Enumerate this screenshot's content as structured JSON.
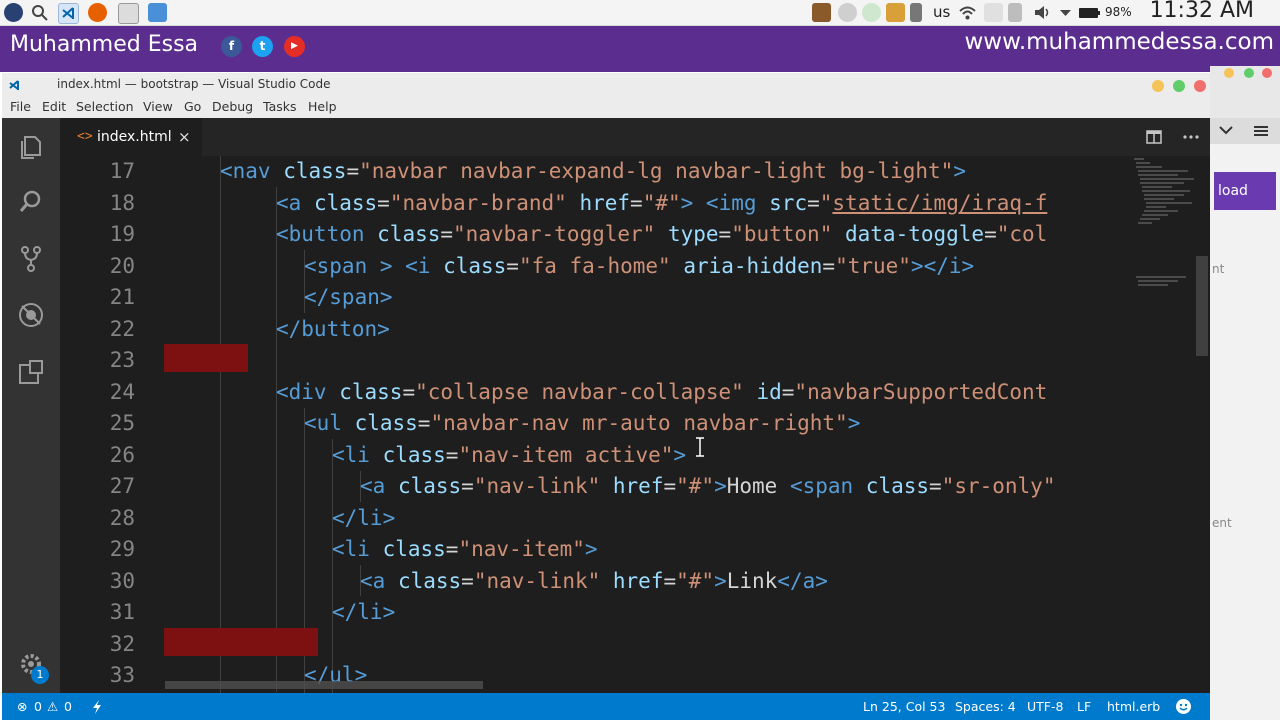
{
  "taskbar": {
    "keyboard_layout": "us",
    "battery": "98%",
    "clock": "11:32 AM"
  },
  "banner": {
    "name": "Muhammed Essa",
    "website": "www.muhammedessa.com",
    "social": [
      {
        "icon": "facebook-icon",
        "glyph": "f",
        "color": "#3b5998"
      },
      {
        "icon": "twitter-icon",
        "glyph": "t",
        "color": "#1da1f2"
      },
      {
        "icon": "youtube-icon",
        "glyph": "▶",
        "color": "#e52d27"
      }
    ]
  },
  "background_window": {
    "button_text": "load",
    "side_text_1": "nt",
    "side_text_2": "ent"
  },
  "window": {
    "title": "index.html — bootstrap — Visual Studio Code",
    "menu": [
      "File",
      "Edit",
      "Selection",
      "View",
      "Go",
      "Debug",
      "Tasks",
      "Help"
    ]
  },
  "tab": {
    "label": "index.html",
    "close": "×",
    "icon_glyph": "<>"
  },
  "editor": {
    "lines": [
      {
        "num": "17",
        "indent": 2,
        "tokens": [
          [
            "tg",
            "<nav "
          ],
          [
            "at",
            "class"
          ],
          [
            "tx",
            "="
          ],
          [
            "st",
            "\"navbar navbar-expand-lg navbar-light bg-light\""
          ],
          [
            "tg",
            ">"
          ]
        ]
      },
      {
        "num": "18",
        "indent": 4,
        "tokens": [
          [
            "tg",
            "<a "
          ],
          [
            "at",
            "class"
          ],
          [
            "tx",
            "="
          ],
          [
            "st",
            "\"navbar-brand\" "
          ],
          [
            "at",
            "href"
          ],
          [
            "tx",
            "="
          ],
          [
            "st",
            "\"#\""
          ],
          [
            "tg",
            "> <img "
          ],
          [
            "at",
            "src"
          ],
          [
            "tx",
            "="
          ],
          [
            "st",
            "\""
          ],
          [
            "stl",
            "static/img/iraq-f"
          ]
        ]
      },
      {
        "num": "19",
        "indent": 4,
        "tokens": [
          [
            "tg",
            "<button "
          ],
          [
            "at",
            "class"
          ],
          [
            "tx",
            "="
          ],
          [
            "st",
            "\"navbar-toggler\" "
          ],
          [
            "at",
            "type"
          ],
          [
            "tx",
            "="
          ],
          [
            "st",
            "\"button\" "
          ],
          [
            "at",
            "data-toggle"
          ],
          [
            "tx",
            "="
          ],
          [
            "st",
            "\"col"
          ]
        ]
      },
      {
        "num": "20",
        "indent": 5,
        "tokens": [
          [
            "tg",
            "<span > <i "
          ],
          [
            "at",
            "class"
          ],
          [
            "tx",
            "="
          ],
          [
            "st",
            "\"fa fa-home\" "
          ],
          [
            "at",
            "aria-hidden"
          ],
          [
            "tx",
            "="
          ],
          [
            "st",
            "\"true\""
          ],
          [
            "tg",
            "></i>"
          ]
        ]
      },
      {
        "num": "21",
        "indent": 5,
        "tokens": [
          [
            "tg",
            "</span>"
          ]
        ]
      },
      {
        "num": "22",
        "indent": 4,
        "tokens": [
          [
            "tg",
            "</button>"
          ]
        ]
      },
      {
        "num": "23",
        "indent": 0,
        "tokens": []
      },
      {
        "num": "24",
        "indent": 4,
        "tokens": [
          [
            "tg",
            "<div "
          ],
          [
            "at",
            "class"
          ],
          [
            "tx",
            "="
          ],
          [
            "st",
            "\"collapse navbar-collapse\" "
          ],
          [
            "at",
            "id"
          ],
          [
            "tx",
            "="
          ],
          [
            "st",
            "\"navbarSupportedCont"
          ]
        ]
      },
      {
        "num": "25",
        "indent": 5,
        "tokens": [
          [
            "tg",
            "<ul "
          ],
          [
            "at",
            "class"
          ],
          [
            "tx",
            "="
          ],
          [
            "st",
            "\"navbar-nav mr-auto navbar-right\""
          ],
          [
            "tg",
            ">"
          ]
        ]
      },
      {
        "num": "26",
        "indent": 6,
        "tokens": [
          [
            "tg",
            "<li "
          ],
          [
            "at",
            "class"
          ],
          [
            "tx",
            "="
          ],
          [
            "st",
            "\"nav-item active\""
          ],
          [
            "tg",
            ">"
          ]
        ]
      },
      {
        "num": "27",
        "indent": 7,
        "tokens": [
          [
            "tg",
            "<a "
          ],
          [
            "at",
            "class"
          ],
          [
            "tx",
            "="
          ],
          [
            "st",
            "\"nav-link\" "
          ],
          [
            "at",
            "href"
          ],
          [
            "tx",
            "="
          ],
          [
            "st",
            "\"#\""
          ],
          [
            "tg",
            ">"
          ],
          [
            "tx",
            "Home "
          ],
          [
            "tg",
            "<span "
          ],
          [
            "at",
            "class"
          ],
          [
            "tx",
            "="
          ],
          [
            "st",
            "\"sr-only\""
          ]
        ]
      },
      {
        "num": "28",
        "indent": 6,
        "tokens": [
          [
            "tg",
            "</li>"
          ]
        ]
      },
      {
        "num": "29",
        "indent": 6,
        "tokens": [
          [
            "tg",
            "<li "
          ],
          [
            "at",
            "class"
          ],
          [
            "tx",
            "="
          ],
          [
            "st",
            "\"nav-item\""
          ],
          [
            "tg",
            ">"
          ]
        ]
      },
      {
        "num": "30",
        "indent": 7,
        "tokens": [
          [
            "tg",
            "<a "
          ],
          [
            "at",
            "class"
          ],
          [
            "tx",
            "="
          ],
          [
            "st",
            "\"nav-link\" "
          ],
          [
            "at",
            "href"
          ],
          [
            "tx",
            "="
          ],
          [
            "st",
            "\"#\""
          ],
          [
            "tg",
            ">"
          ],
          [
            "tx",
            "Link"
          ],
          [
            "tg",
            "</a>"
          ]
        ]
      },
      {
        "num": "31",
        "indent": 6,
        "tokens": [
          [
            "tg",
            "</li>"
          ]
        ]
      },
      {
        "num": "32",
        "indent": 0,
        "tokens": []
      },
      {
        "num": "33",
        "indent": 5,
        "tokens": [
          [
            "tg",
            "</ul>"
          ]
        ]
      }
    ],
    "error_lines": [
      "23",
      "32"
    ]
  },
  "status": {
    "errors": "0",
    "warnings": "0",
    "position": "Ln 25, Col 53",
    "spaces": "Spaces: 4",
    "encoding": "UTF-8",
    "eol": "LF",
    "language": "html.erb"
  },
  "settings_badge": "1",
  "colors": {
    "banner": "#5b2d8e",
    "statusbar": "#007acc",
    "editor_bg": "#1e1e1e",
    "tag": "#569cd6",
    "attribute": "#9cdcfe",
    "string": "#ce9178",
    "error_highlight": "#7d1111"
  }
}
